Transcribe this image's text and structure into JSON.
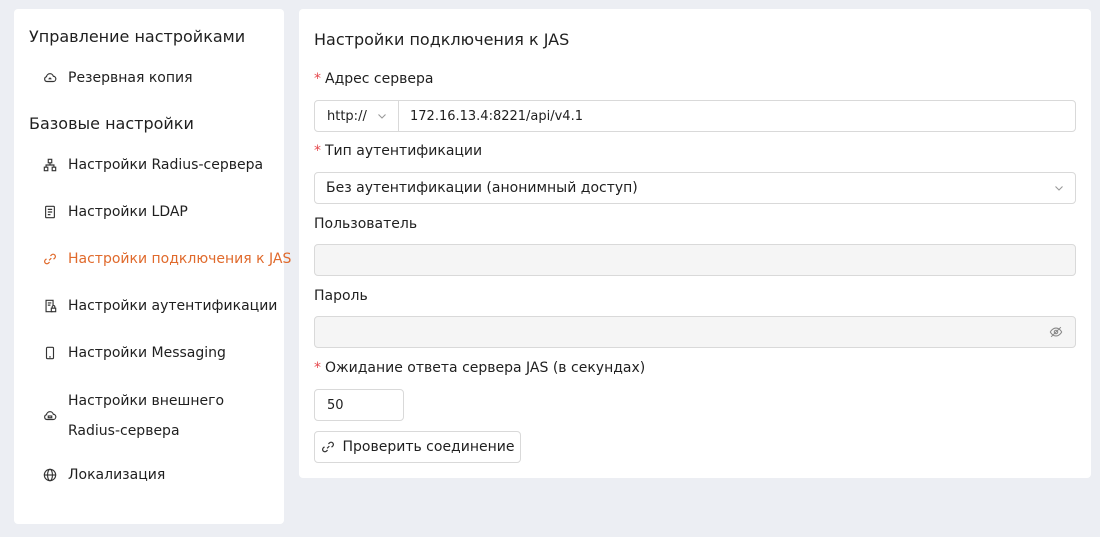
{
  "sidebar": {
    "group1_title": "Управление настройками",
    "group2_title": "Базовые настройки",
    "items": [
      {
        "label": "Резервная копия",
        "icon": "cloud-sync-icon"
      },
      {
        "label": "Настройки Radius-сервера",
        "icon": "cluster-icon"
      },
      {
        "label": "Настройки LDAP",
        "icon": "database-icon"
      },
      {
        "label": "Настройки подключения к JAS",
        "icon": "link-icon",
        "active": true
      },
      {
        "label": "Настройки аутентификации",
        "icon": "file-lock-icon"
      },
      {
        "label": "Настройки Messaging",
        "icon": "mobile-icon"
      },
      {
        "label": "Настройки внешнего Radius-сервера",
        "icon": "cloud-server-icon"
      },
      {
        "label": "Локализация",
        "icon": "globe-icon"
      }
    ]
  },
  "panel": {
    "title": "Настройки подключения к JAS",
    "server_address_label": "Адрес сервера",
    "protocol": "http://",
    "server_address_value": "172.16.13.4:8221/api/v4.1",
    "auth_type_label": "Тип аутентификации",
    "auth_type_value": "Без аутентификации (анонимный доступ)",
    "user_label": "Пользователь",
    "password_label": "Пароль",
    "timeout_label": "Ожидание ответа сервера JAS (в секундах)",
    "timeout_value": "50",
    "check_button": "Проверить соединение",
    "required_mark": "*"
  },
  "colors": {
    "accent": "#e06a2c",
    "required": "#e5484d",
    "background": "#eceef3"
  }
}
